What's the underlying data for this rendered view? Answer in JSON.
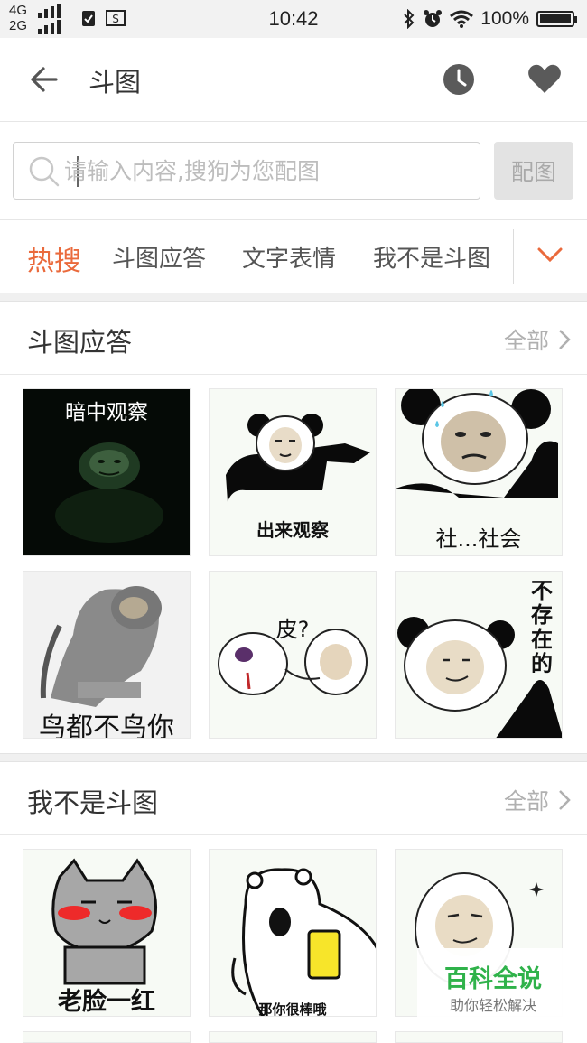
{
  "status_bar": {
    "network_top": "4G",
    "network_bottom": "2G",
    "time": "10:42",
    "battery": "100%"
  },
  "header": {
    "title": "斗图"
  },
  "search": {
    "placeholder": "请输入内容,搜狗为您配图",
    "button_label": "配图"
  },
  "tabs": [
    {
      "label": "热搜",
      "active": true
    },
    {
      "label": "斗图应答",
      "active": false
    },
    {
      "label": "文字表情",
      "active": false
    },
    {
      "label": "我不是斗图",
      "active": false
    }
  ],
  "sections": [
    {
      "title": "斗图应答",
      "more_label": "全部",
      "stickers": [
        {
          "caption": "暗中观察"
        },
        {
          "caption": "出来观察"
        },
        {
          "caption": "社...社会"
        },
        {
          "caption": "鸟都不鸟你"
        },
        {
          "caption": "皮?"
        },
        {
          "caption": "不存在的"
        }
      ]
    },
    {
      "title": "我不是斗图",
      "more_label": "全部",
      "stickers": [
        {
          "caption": "老脸一红"
        },
        {
          "caption": "那你很棒哦"
        },
        {
          "caption": ""
        }
      ]
    }
  ],
  "watermark": {
    "main": "百科全说",
    "sub": "助你轻松解决"
  },
  "colors": {
    "accent": "#ea6a3c",
    "watermark_green": "#2fb24a"
  }
}
